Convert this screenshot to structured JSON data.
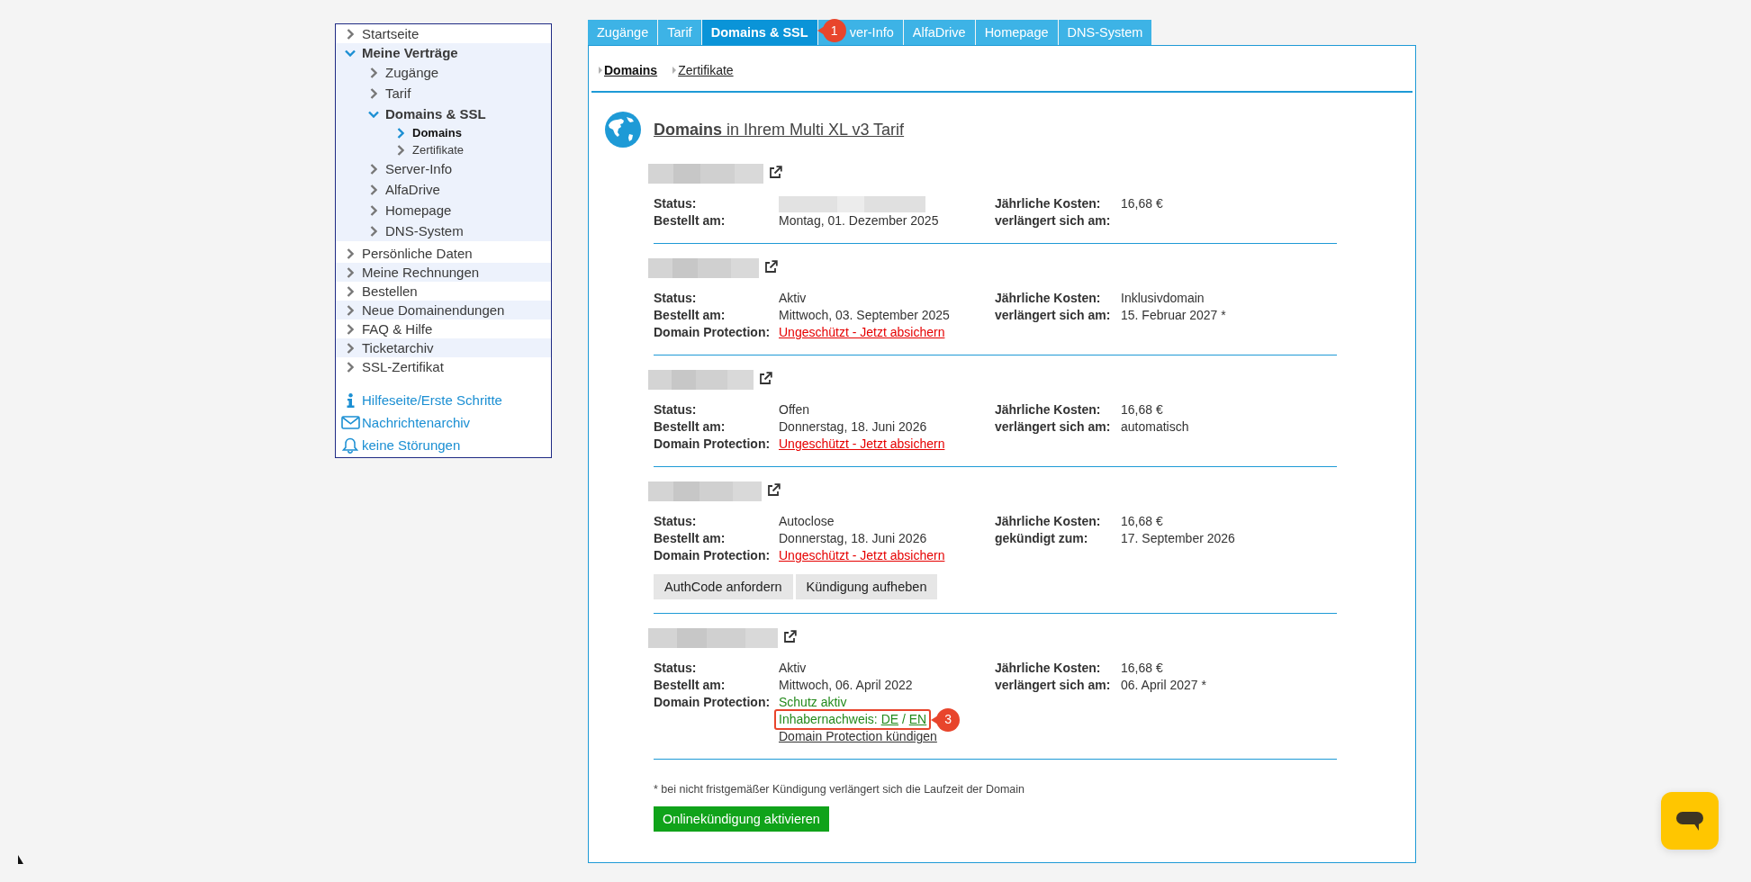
{
  "sidebar": {
    "items": [
      {
        "label": "Startseite",
        "expanded": false,
        "selected": false
      },
      {
        "label": "Meine Verträge",
        "expanded": true,
        "selected": false,
        "children": [
          {
            "label": "Zugänge",
            "expanded": false,
            "selected": false
          },
          {
            "label": "Tarif",
            "expanded": false,
            "selected": false
          },
          {
            "label": "Domains & SSL",
            "expanded": true,
            "selected": false,
            "children": [
              {
                "label": "Domains",
                "expanded": false,
                "selected": true
              },
              {
                "label": "Zertifikate",
                "expanded": false,
                "selected": false
              }
            ]
          },
          {
            "label": "Server-Info",
            "expanded": false,
            "selected": false
          },
          {
            "label": "AlfaDrive",
            "expanded": false,
            "selected": false
          },
          {
            "label": "Homepage",
            "expanded": false,
            "selected": false
          },
          {
            "label": "DNS-System",
            "expanded": false,
            "selected": false
          }
        ]
      },
      {
        "label": "Persönliche Daten",
        "expanded": false,
        "selected": false
      },
      {
        "label": "Meine Rechnungen",
        "expanded": false,
        "selected": false
      },
      {
        "label": "Bestellen",
        "expanded": false,
        "selected": false
      },
      {
        "label": "Neue Domainendungen",
        "expanded": false,
        "selected": false
      },
      {
        "label": "FAQ & Hilfe",
        "expanded": false,
        "selected": false
      },
      {
        "label": "Ticketarchiv",
        "expanded": false,
        "selected": false
      },
      {
        "label": "SSL-Zertifikat",
        "expanded": false,
        "selected": false
      }
    ],
    "links": [
      {
        "kind": "help",
        "label": "Hilfeseite/Erste Schritte"
      },
      {
        "kind": "messages",
        "label": "Nachrichtenarchiv"
      },
      {
        "kind": "alerts",
        "label": "keine Störungen"
      }
    ]
  },
  "tabs": [
    {
      "label": "Zugänge",
      "selected": false
    },
    {
      "label": "Tarif",
      "selected": false
    },
    {
      "label": "Domains & SSL",
      "selected": true,
      "annotation": "1"
    },
    {
      "label": "ver-Info",
      "selected": false
    },
    {
      "label": "AlfaDrive",
      "selected": false
    },
    {
      "label": "Homepage",
      "selected": false
    },
    {
      "label": "DNS-System",
      "selected": false
    }
  ],
  "subtabs": [
    {
      "label": "Domains",
      "selected": true
    },
    {
      "label": "Zertifikate",
      "selected": false
    }
  ],
  "heading": "**Domains** in Ihrem Multi XL v3 Tarif",
  "domains": [
    {
      "fields": [
        {
          "label": "Status:",
          "kind": "redacted"
        },
        {
          "label": "Bestellt am:",
          "kind": "text",
          "value": "Montag, 01. Dezember 2025"
        }
      ],
      "costs": [
        {
          "label": "Jährliche Kosten:",
          "value": "16,68 €"
        },
        {
          "label": "verlängert sich am:"
        }
      ]
    },
    {
      "fields": [
        {
          "label": "Status:",
          "kind": "text",
          "value": "Aktiv"
        },
        {
          "label": "Bestellt am:",
          "kind": "text",
          "value": "Mittwoch, 03. September 2025"
        },
        {
          "label": "Domain Protection:",
          "kind": "alert-link",
          "value": "Ungeschützt - Jetzt absichern"
        }
      ],
      "costs": [
        {
          "label": "Jährliche Kosten:",
          "value": "Inklusivdomain"
        },
        {
          "label": "verlängert sich am:",
          "value": "15. Februar 2027 *"
        }
      ]
    },
    {
      "fields": [
        {
          "label": "Status:",
          "kind": "text",
          "value": "Offen"
        },
        {
          "label": "Bestellt am:",
          "kind": "text",
          "value": "Donnerstag, 18. Juni 2026"
        },
        {
          "label": "Domain Protection:",
          "kind": "alert-link",
          "value": "Ungeschützt - Jetzt absichern"
        }
      ],
      "costs": [
        {
          "label": "Jährliche Kosten:",
          "value": "16,68 €"
        },
        {
          "label": "verlängert sich am:",
          "value": "automatisch"
        }
      ]
    },
    {
      "fields": [
        {
          "label": "Status:",
          "kind": "text",
          "value": "Autoclose"
        },
        {
          "label": "Bestellt am:",
          "kind": "text",
          "value": "Donnerstag, 18. Juni 2026"
        },
        {
          "label": "Domain Protection:",
          "kind": "alert-link",
          "value": "Ungeschützt - Jetzt absichern"
        }
      ],
      "costs": [
        {
          "label": "Jährliche Kosten:",
          "value": "16,68 €"
        },
        {
          "label": "gekündigt zum:",
          "value": "17. September 2026"
        }
      ],
      "buttons": [
        "AuthCode anfordern",
        "Kündigung aufheben"
      ]
    },
    {
      "fields": [
        {
          "label": "Status:",
          "kind": "text",
          "value": "Aktiv"
        },
        {
          "label": "Bestellt am:",
          "kind": "text",
          "value": "Mittwoch, 06. April 2022"
        },
        {
          "label": "Domain Protection:",
          "kind": "protected",
          "value": "Schutz aktiv",
          "proof": {
            "label": "Inhabernachweis:",
            "links": [
              "DE",
              "EN"
            ],
            "separator": "/",
            "annotation": "3"
          },
          "cancel": "Domain Protection kündigen"
        }
      ],
      "costs": [
        {
          "label": "Jährliche Kosten:",
          "value": "16,68 €"
        },
        {
          "label": "verlängert sich am:",
          "value": "06. April 2027 *"
        }
      ]
    }
  ],
  "footnote": "* bei nicht fristgemäßer Kündigung verlängert sich die Laufzeit der Domain",
  "primary_button": "Onlinekündigung aktivieren"
}
